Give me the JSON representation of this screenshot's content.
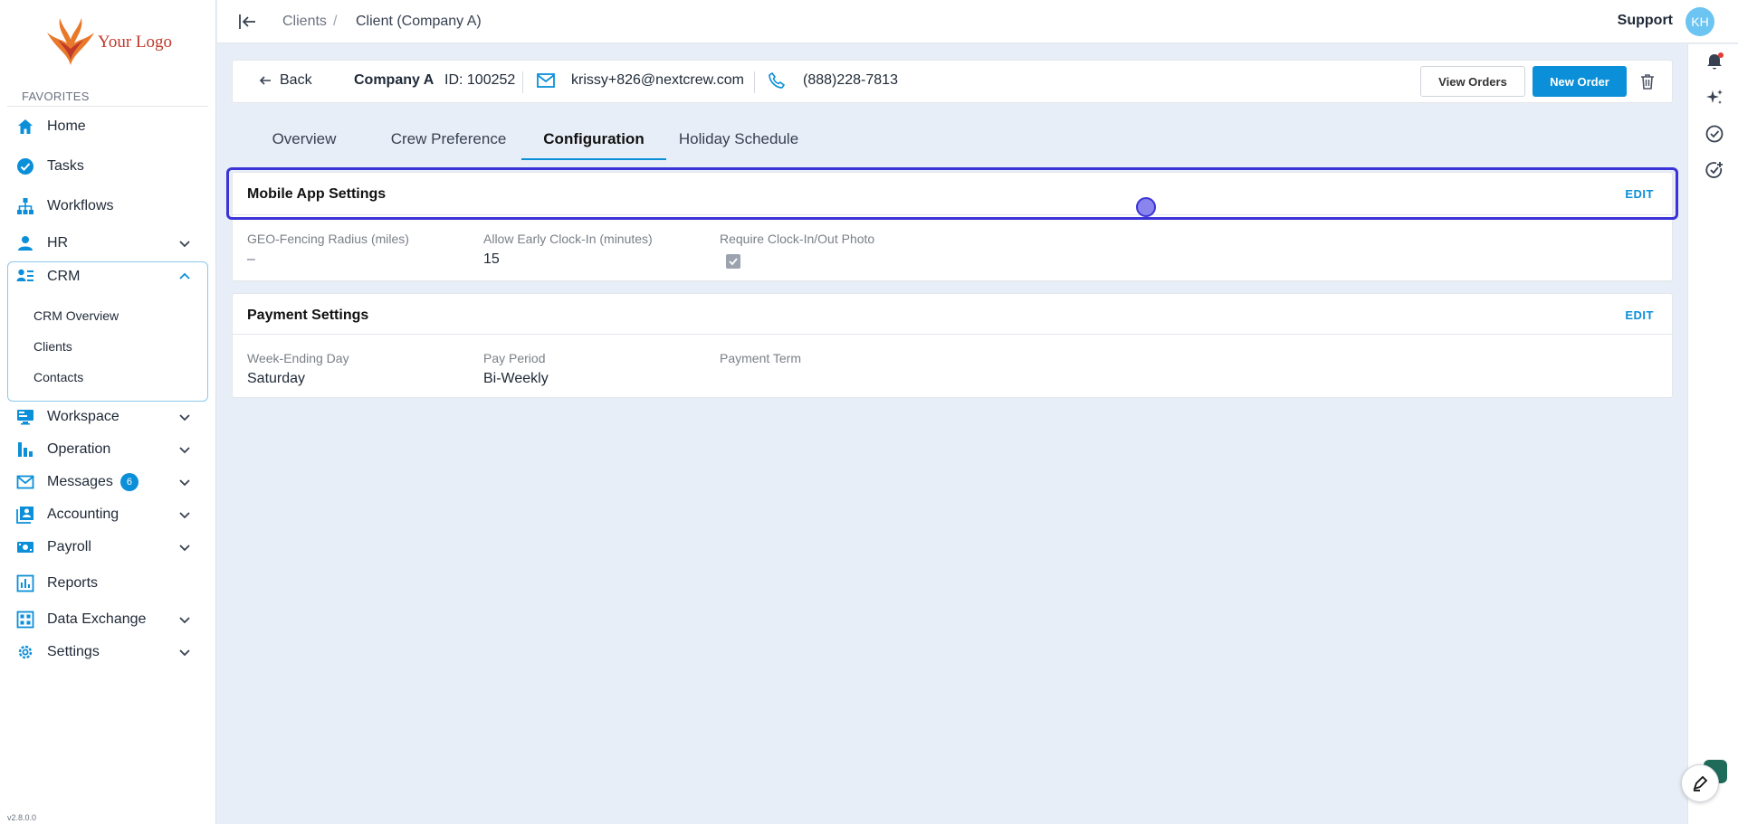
{
  "sidebar": {
    "logo_text": "Your Logo",
    "favorites_label": "FAVORITES",
    "items": [
      {
        "label": "Home",
        "icon": "home-icon"
      },
      {
        "label": "Tasks",
        "icon": "check-circle-icon"
      },
      {
        "label": "Workflows",
        "icon": "workflow-icon"
      },
      {
        "label": "HR",
        "icon": "person-icon"
      },
      {
        "label": "CRM",
        "icon": "crm-icon"
      },
      {
        "label": "Workspace",
        "icon": "monitor-icon"
      },
      {
        "label": "Operation",
        "icon": "bar-chart-icon"
      },
      {
        "label": "Messages",
        "icon": "mail-icon",
        "badge": "6"
      },
      {
        "label": "Accounting",
        "icon": "accounting-icon"
      },
      {
        "label": "Payroll",
        "icon": "payroll-icon"
      },
      {
        "label": "Reports",
        "icon": "reports-icon"
      },
      {
        "label": "Data Exchange",
        "icon": "grid-icon"
      },
      {
        "label": "Settings",
        "icon": "gear-icon"
      }
    ],
    "crm_sub": [
      "CRM Overview",
      "Clients",
      "Contacts"
    ],
    "version": "v2.8.0.0"
  },
  "topbar": {
    "breadcrumb": [
      "Clients",
      "Client (Company A)"
    ],
    "breadcrumb_sep": "/",
    "support_label": "Support",
    "avatar_initials": "KH"
  },
  "client": {
    "back_label": "Back",
    "name": "Company A",
    "id_label": "ID: 100252",
    "email": "krissy+826@nextcrew.com",
    "phone": "(888)228-7813",
    "view_orders_label": "View Orders",
    "new_order_label": "New Order"
  },
  "tabs": [
    "Overview",
    "Crew Preference",
    "Configuration",
    "Holiday Schedule"
  ],
  "active_tab": "Configuration",
  "mobile_settings": {
    "title": "Mobile App Settings",
    "edit_label": "EDIT",
    "fields": [
      {
        "label": "GEO-Fencing Radius (miles)",
        "value": "–"
      },
      {
        "label": "Allow Early Clock-In (minutes)",
        "value": "15"
      },
      {
        "label": "Require Clock-In/Out Photo",
        "checked": true
      }
    ]
  },
  "payment_settings": {
    "title": "Payment Settings",
    "edit_label": "EDIT",
    "fields": [
      {
        "label": "Week-Ending Day",
        "value": "Saturday"
      },
      {
        "label": "Pay Period",
        "value": "Bi-Weekly"
      },
      {
        "label": "Payment Term",
        "value": ""
      }
    ]
  },
  "colors": {
    "accent": "#0a8fd8",
    "highlight": "#3b33d6"
  }
}
